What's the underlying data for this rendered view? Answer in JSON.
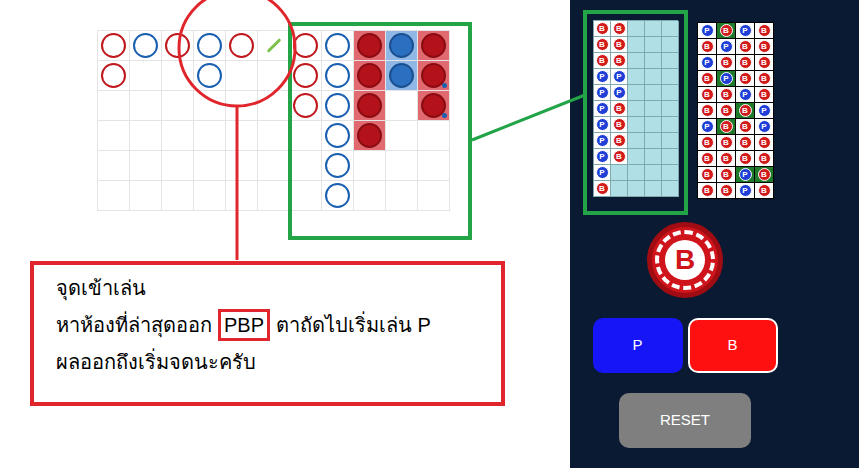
{
  "scoreboard": {
    "columns": [
      [
        {
          "side": "B",
          "filled": false,
          "pair": false
        },
        {
          "side": "B",
          "filled": false,
          "pair": false
        }
      ],
      [
        {
          "side": "P",
          "filled": false,
          "pair": false
        }
      ],
      [
        {
          "side": "B",
          "filled": false,
          "pair": false
        }
      ],
      [
        {
          "side": "P",
          "filled": false,
          "pair": false
        },
        {
          "side": "P",
          "filled": false,
          "pair": false
        }
      ],
      [
        {
          "side": "B",
          "filled": false,
          "pair": false
        }
      ],
      [
        {
          "side": "T",
          "filled": false,
          "pair": false
        }
      ],
      [
        {
          "side": "B",
          "filled": false,
          "pair": false
        },
        {
          "side": "B",
          "filled": false,
          "pair": false
        },
        {
          "side": "B",
          "filled": false,
          "pair": false
        }
      ],
      [
        {
          "side": "P",
          "filled": false,
          "pair": false
        },
        {
          "side": "P",
          "filled": false,
          "pair": false
        },
        {
          "side": "P",
          "filled": false,
          "pair": false
        },
        {
          "side": "P",
          "filled": false,
          "pair": false
        },
        {
          "side": "P",
          "filled": false,
          "pair": false
        },
        {
          "side": "P",
          "filled": false,
          "pair": false
        }
      ],
      [
        {
          "side": "B",
          "filled": true,
          "pair": false
        },
        {
          "side": "B",
          "filled": true,
          "pair": false
        },
        {
          "side": "B",
          "filled": true,
          "pair": false
        },
        {
          "side": "B",
          "filled": true,
          "pair": false
        }
      ],
      [
        {
          "side": "P",
          "filled": true,
          "pair": false
        },
        {
          "side": "P",
          "filled": true,
          "pair": false
        }
      ],
      [
        {
          "side": "B",
          "filled": true,
          "pair": false
        },
        {
          "side": "B",
          "filled": true,
          "pair": true
        },
        {
          "side": "B",
          "filled": true,
          "pair": true
        }
      ]
    ]
  },
  "annotation": {
    "title": "จุดเข้าเล่น",
    "line": [
      {
        "text": "หาห้องที่ล่าสุดออก",
        "boxed": false
      },
      {
        "text": "PBP",
        "boxed": true
      },
      {
        "text": "ตาถัดไปเริ่มเล่น P",
        "boxed": false
      }
    ],
    "footer": "ผลออกถึงเริ่มจดนะครับ"
  },
  "bead_grid": {
    "columns": [
      [
        "B",
        "B",
        "B",
        "P",
        "P",
        "P",
        "P",
        "P",
        "P",
        "P",
        "B"
      ],
      [
        "B",
        "B",
        "B",
        "P",
        "P",
        "B",
        "B",
        "B",
        "B",
        "",
        ""
      ],
      [
        "",
        "",
        "",
        "",
        "",
        "",
        "",
        "",
        "",
        "",
        ""
      ],
      [
        "",
        "",
        "",
        "",
        "",
        "",
        "",
        "",
        "",
        "",
        ""
      ],
      [
        "",
        "",
        "",
        "",
        "",
        "",
        "",
        "",
        "",
        "",
        ""
      ]
    ]
  },
  "result_grid": {
    "rows": [
      [
        {
          "side": "P",
          "highlight": false
        },
        {
          "side": "B",
          "highlight": true
        },
        {
          "side": "P",
          "highlight": false
        },
        {
          "side": "B",
          "highlight": false
        }
      ],
      [
        {
          "side": "B",
          "highlight": false
        },
        {
          "side": "P",
          "highlight": false
        },
        {
          "side": "B",
          "highlight": false
        },
        {
          "side": "B",
          "highlight": false
        }
      ],
      [
        {
          "side": "P",
          "highlight": false
        },
        {
          "side": "B",
          "highlight": false
        },
        {
          "side": "B",
          "highlight": false
        },
        {
          "side": "B",
          "highlight": false
        }
      ],
      [
        {
          "side": "B",
          "highlight": false
        },
        {
          "side": "P",
          "highlight": true
        },
        {
          "side": "B",
          "highlight": false
        },
        {
          "side": "B",
          "highlight": false
        }
      ],
      [
        {
          "side": "B",
          "highlight": false
        },
        {
          "side": "B",
          "highlight": false
        },
        {
          "side": "P",
          "highlight": false
        },
        {
          "side": "B",
          "highlight": false
        }
      ],
      [
        {
          "side": "B",
          "highlight": false
        },
        {
          "side": "B",
          "highlight": false
        },
        {
          "side": "B",
          "highlight": true
        },
        {
          "side": "P",
          "highlight": false
        }
      ],
      [
        {
          "side": "P",
          "highlight": false
        },
        {
          "side": "B",
          "highlight": true
        },
        {
          "side": "B",
          "highlight": false
        },
        {
          "side": "P",
          "highlight": false
        }
      ],
      [
        {
          "side": "B",
          "highlight": false
        },
        {
          "side": "B",
          "highlight": false
        },
        {
          "side": "B",
          "highlight": false
        },
        {
          "side": "B",
          "highlight": false
        }
      ],
      [
        {
          "side": "B",
          "highlight": false
        },
        {
          "side": "B",
          "highlight": false
        },
        {
          "side": "B",
          "highlight": false
        },
        {
          "side": "B",
          "highlight": false
        }
      ],
      [
        {
          "side": "B",
          "highlight": false
        },
        {
          "side": "B",
          "highlight": false
        },
        {
          "side": "P",
          "highlight": true
        },
        {
          "side": "B",
          "highlight": true
        }
      ],
      [
        {
          "side": "B",
          "highlight": false
        },
        {
          "side": "B",
          "highlight": false
        },
        {
          "side": "P",
          "highlight": false
        },
        {
          "side": "B",
          "highlight": false
        }
      ]
    ]
  },
  "chip": {
    "label": "B"
  },
  "buttons": [
    {
      "label": "P",
      "color": "#1515f5"
    },
    {
      "label": "B",
      "color": "#ff1010"
    }
  ],
  "reset": {
    "label": "RESET"
  }
}
